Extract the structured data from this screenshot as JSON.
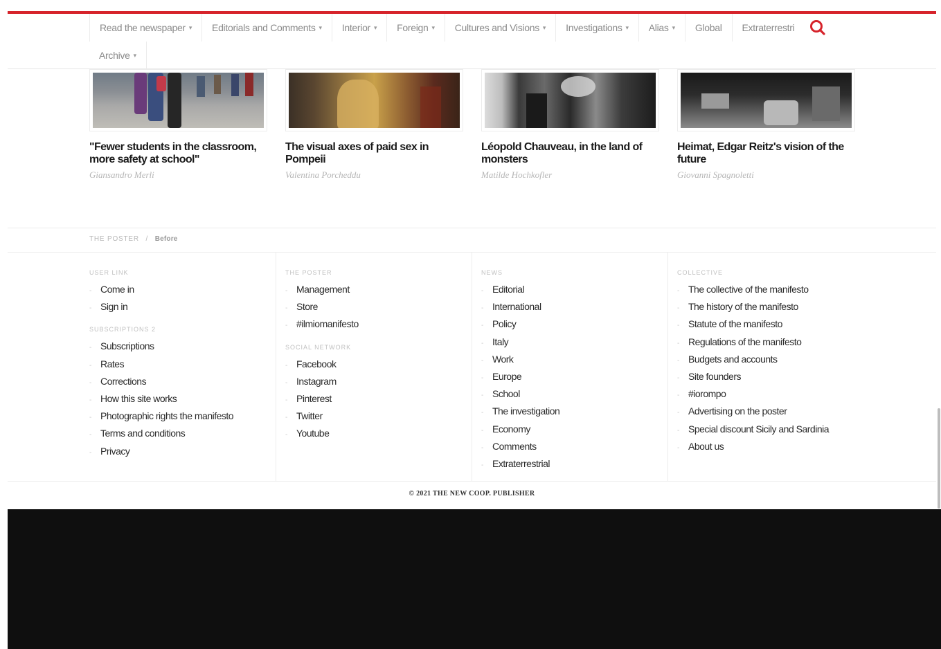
{
  "colors": {
    "accent": "#d6232b",
    "footer_bg": "#0f0f0f"
  },
  "nav": {
    "items": [
      {
        "label": "Read the newspaper",
        "dropdown": true
      },
      {
        "label": "Editorials and Comments",
        "dropdown": true
      },
      {
        "label": "Interior",
        "dropdown": true
      },
      {
        "label": "Foreign",
        "dropdown": true
      },
      {
        "label": "Cultures and Visions",
        "dropdown": true
      },
      {
        "label": "Investigations",
        "dropdown": true
      },
      {
        "label": "Alias",
        "dropdown": true
      },
      {
        "label": "Global",
        "dropdown": false
      },
      {
        "label": "Extraterrestri",
        "dropdown": false
      }
    ],
    "archive": {
      "label": "Archive",
      "dropdown": true
    },
    "caret": "▾",
    "search_icon": "search-icon"
  },
  "articles": [
    {
      "title": "\"Fewer students in the classroom, more safety at school\"",
      "author": "Giansandro Merli"
    },
    {
      "title": "The visual axes of paid sex in Pompeii",
      "author": "Valentina Porcheddu"
    },
    {
      "title": "Léopold Chauveau, in the land of monsters",
      "author": "Matilde Hochkofler"
    },
    {
      "title": "Heimat, Edgar Reitz's vision of the future",
      "author": "Giovanni Spagnoletti"
    }
  ],
  "breadcrumb": {
    "root": "THE POSTER",
    "separator": "/",
    "current": "Before"
  },
  "footer": {
    "col1": {
      "heading1": "USER LINK",
      "list1": [
        "Come in",
        "Sign in"
      ],
      "heading2": "SUBSCRIPTIONS 2",
      "list2": [
        "Subscriptions",
        "Rates",
        "Corrections",
        "How this site works",
        "Photographic rights the manifesto",
        "Terms and conditions",
        "Privacy"
      ]
    },
    "col2": {
      "heading1": "THE POSTER",
      "list1": [
        "Management",
        "Store",
        "#ilmiomanifesto"
      ],
      "heading2": "SOCIAL NETWORK",
      "list2": [
        "Facebook",
        "Instagram",
        "Pinterest",
        "Twitter",
        "Youtube"
      ]
    },
    "col3": {
      "heading1": "NEWS",
      "list1": [
        "Editorial",
        "International",
        "Policy",
        "Italy",
        "Work",
        "Europe",
        "School",
        "The investigation",
        "Economy",
        "Comments",
        "Extraterrestrial"
      ]
    },
    "col4": {
      "heading1": "COLLECTIVE",
      "list1": [
        "The collective of the manifesto",
        "The history of the manifesto",
        "Statute of the manifesto",
        "Regulations of the manifesto",
        "Budgets and accounts",
        "Site founders",
        "#iorompo",
        "Advertising on the poster",
        "Special discount Sicily and Sardinia",
        "About us"
      ]
    }
  },
  "copyright": "© 2021 THE NEW COOP. PUBLISHER"
}
